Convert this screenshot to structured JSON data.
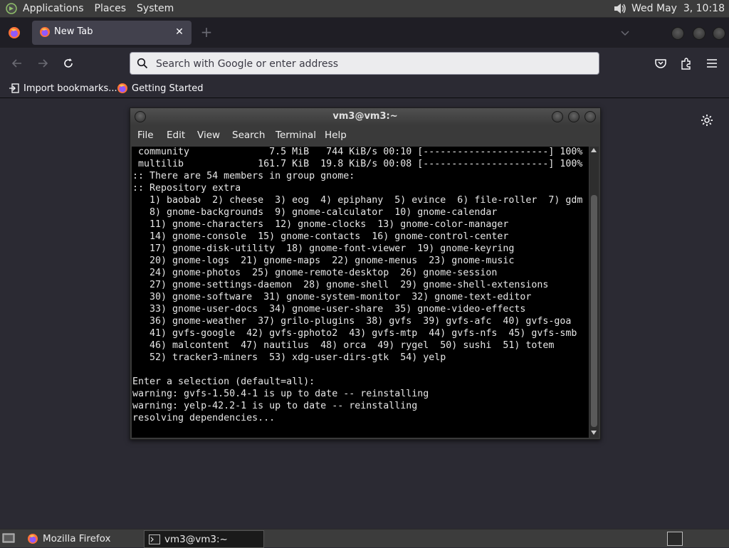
{
  "top_panel": {
    "menus": [
      "Applications",
      "Places",
      "System"
    ],
    "clock": "Wed May  3, 10:18"
  },
  "browser": {
    "tab_title": "New Tab",
    "new_tab_symbol": "+",
    "close_symbol": "✕",
    "address_placeholder": "Search with Google or enter address",
    "bookmarks": [
      "Import bookmarks...",
      "Getting Started"
    ]
  },
  "terminal": {
    "title": "vm3@vm3:~",
    "menus": [
      "File",
      "Edit",
      "View",
      "Search",
      "Terminal",
      "Help"
    ],
    "output": " community              7.5 MiB   744 KiB/s 00:10 [----------------------] 100%\n multilib             161.7 KiB  19.8 KiB/s 00:08 [----------------------] 100%\n:: There are 54 members in group gnome:\n:: Repository extra\n   1) baobab  2) cheese  3) eog  4) epiphany  5) evince  6) file-roller  7) gdm\n   8) gnome-backgrounds  9) gnome-calculator  10) gnome-calendar\n   11) gnome-characters  12) gnome-clocks  13) gnome-color-manager\n   14) gnome-console  15) gnome-contacts  16) gnome-control-center\n   17) gnome-disk-utility  18) gnome-font-viewer  19) gnome-keyring\n   20) gnome-logs  21) gnome-maps  22) gnome-menus  23) gnome-music\n   24) gnome-photos  25) gnome-remote-desktop  26) gnome-session\n   27) gnome-settings-daemon  28) gnome-shell  29) gnome-shell-extensions\n   30) gnome-software  31) gnome-system-monitor  32) gnome-text-editor\n   33) gnome-user-docs  34) gnome-user-share  35) gnome-video-effects\n   36) gnome-weather  37) grilo-plugins  38) gvfs  39) gvfs-afc  40) gvfs-goa\n   41) gvfs-google  42) gvfs-gphoto2  43) gvfs-mtp  44) gvfs-nfs  45) gvfs-smb\n   46) malcontent  47) nautilus  48) orca  49) rygel  50) sushi  51) totem\n   52) tracker3-miners  53) xdg-user-dirs-gtk  54) yelp\n\nEnter a selection (default=all):\nwarning: gvfs-1.50.4-1 is up to date -- reinstalling\nwarning: yelp-42.2-1 is up to date -- reinstalling\nresolving dependencies..."
  },
  "taskbar": {
    "tasks": [
      "Mozilla Firefox",
      "vm3@vm3:~"
    ]
  }
}
